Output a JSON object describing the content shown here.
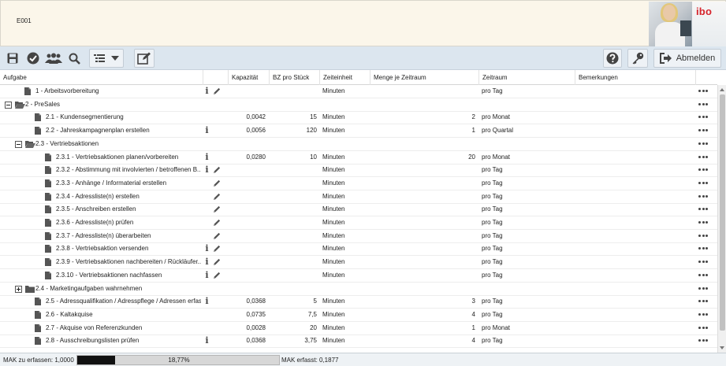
{
  "header": {
    "app_code": "E001",
    "logo_text": "ibo"
  },
  "toolbar": {
    "icons": [
      "save-icon",
      "check-icon",
      "users-icon",
      "search-icon",
      "list-view-icon",
      "chevron-down-icon",
      "edit-icon",
      "help-icon",
      "key-icon",
      "logout-icon"
    ],
    "logout_label": "Abmelden"
  },
  "grid": {
    "columns": {
      "aufgabe": "Aufgabe",
      "kapazitaet": "Kapazität",
      "bz_pro_stueck": "BZ pro Stück",
      "zeiteinheit": "Zeiteinheit",
      "menge_je_zeitraum": "Menge je Zeitraum",
      "zeitraum": "Zeitraum",
      "bemerkungen": "Bemerkungen"
    },
    "rows": [
      {
        "level": 1,
        "node": "doc",
        "label": "1 - Arbeitsvorbereitung",
        "info": true,
        "edit": true,
        "kapazitaet": "",
        "bz": "",
        "einheit": "Minuten",
        "menge": "",
        "zeitraum": "pro Tag"
      },
      {
        "level": 0,
        "node": "folder-open",
        "toggle": "minus",
        "label": "2 - PreSales",
        "info": false,
        "edit": false,
        "kapazitaet": "",
        "bz": "",
        "einheit": "",
        "menge": "",
        "zeitraum": ""
      },
      {
        "level": 2,
        "node": "doc",
        "label": "2.1 - Kundensegmentierung",
        "info": false,
        "edit": false,
        "kapazitaet": "0,0042",
        "bz": "15",
        "einheit": "Minuten",
        "menge": "2",
        "zeitraum": "pro Monat"
      },
      {
        "level": 2,
        "node": "doc",
        "label": "2.2 - Jahreskampagnenplan erstellen",
        "info": true,
        "edit": false,
        "kapazitaet": "0,0056",
        "bz": "120",
        "einheit": "Minuten",
        "menge": "1",
        "zeitraum": "pro Quartal"
      },
      {
        "level": 1,
        "node": "folder-open",
        "toggle": "minus",
        "label": "2.3 - Vertriebsaktionen",
        "info": false,
        "edit": false,
        "kapazitaet": "",
        "bz": "",
        "einheit": "",
        "menge": "",
        "zeitraum": ""
      },
      {
        "level": 3,
        "node": "doc",
        "label": "2.3.1 - Vertriebsaktionen planen/vorbereiten",
        "info": true,
        "edit": false,
        "kapazitaet": "0,0280",
        "bz": "10",
        "einheit": "Minuten",
        "menge": "20",
        "zeitraum": "pro Monat"
      },
      {
        "level": 3,
        "node": "doc",
        "label": "2.3.2 - Abstimmung mit involvierten / betroffenen B...",
        "info": true,
        "edit": true,
        "kapazitaet": "",
        "bz": "",
        "einheit": "Minuten",
        "menge": "",
        "zeitraum": "pro Tag"
      },
      {
        "level": 3,
        "node": "doc",
        "label": "2.3.3 - Anhänge / Informaterial erstellen",
        "info": false,
        "edit": true,
        "kapazitaet": "",
        "bz": "",
        "einheit": "Minuten",
        "menge": "",
        "zeitraum": "pro Tag"
      },
      {
        "level": 3,
        "node": "doc",
        "label": "2.3.4 - Adressliste(n) erstellen",
        "info": false,
        "edit": true,
        "kapazitaet": "",
        "bz": "",
        "einheit": "Minuten",
        "menge": "",
        "zeitraum": "pro Tag"
      },
      {
        "level": 3,
        "node": "doc",
        "label": "2.3.5 - Anschreiben erstellen",
        "info": false,
        "edit": true,
        "kapazitaet": "",
        "bz": "",
        "einheit": "Minuten",
        "menge": "",
        "zeitraum": "pro Tag"
      },
      {
        "level": 3,
        "node": "doc",
        "label": "2.3.6 - Adressliste(n) prüfen",
        "info": false,
        "edit": true,
        "kapazitaet": "",
        "bz": "",
        "einheit": "Minuten",
        "menge": "",
        "zeitraum": "pro Tag"
      },
      {
        "level": 3,
        "node": "doc",
        "label": "2.3.7 - Adressliste(n) überarbeiten",
        "info": false,
        "edit": true,
        "kapazitaet": "",
        "bz": "",
        "einheit": "Minuten",
        "menge": "",
        "zeitraum": "pro Tag"
      },
      {
        "level": 3,
        "node": "doc",
        "label": "2.3.8 - Vertriebsaktion versenden",
        "info": true,
        "edit": true,
        "kapazitaet": "",
        "bz": "",
        "einheit": "Minuten",
        "menge": "",
        "zeitraum": "pro Tag"
      },
      {
        "level": 3,
        "node": "doc",
        "label": "2.3.9 - Vertriebsaktionen nachbereiten / Rückläufer...",
        "info": true,
        "edit": true,
        "kapazitaet": "",
        "bz": "",
        "einheit": "Minuten",
        "menge": "",
        "zeitraum": "pro Tag"
      },
      {
        "level": 3,
        "node": "doc",
        "label": "2.3.10 - Vertriebsaktionen nachfassen",
        "info": true,
        "edit": true,
        "kapazitaet": "",
        "bz": "",
        "einheit": "Minuten",
        "menge": "",
        "zeitraum": "pro Tag"
      },
      {
        "level": 1,
        "node": "folder-closed",
        "toggle": "plus",
        "label": "2.4 - Marketingaufgaben wahrnehmen",
        "info": false,
        "edit": false,
        "kapazitaet": "",
        "bz": "",
        "einheit": "",
        "menge": "",
        "zeitraum": ""
      },
      {
        "level": 2,
        "node": "doc",
        "label": "2.5 - Adressqualifikation / Adresspflege / Adressen erfas...",
        "info": true,
        "edit": false,
        "kapazitaet": "0,0368",
        "bz": "5",
        "einheit": "Minuten",
        "menge": "3",
        "zeitraum": "pro Tag"
      },
      {
        "level": 2,
        "node": "doc",
        "label": "2.6 - Kaltakquise",
        "info": false,
        "edit": false,
        "kapazitaet": "0,0735",
        "bz": "7,5",
        "einheit": "Minuten",
        "menge": "4",
        "zeitraum": "pro Tag"
      },
      {
        "level": 2,
        "node": "doc",
        "label": "2.7 - Akquise von Referenzkunden",
        "info": false,
        "edit": false,
        "kapazitaet": "0,0028",
        "bz": "20",
        "einheit": "Minuten",
        "menge": "1",
        "zeitraum": "pro Monat"
      },
      {
        "level": 2,
        "node": "doc",
        "label": "2.8 - Ausschreibungslisten prüfen",
        "info": true,
        "edit": false,
        "kapazitaet": "0,0368",
        "bz": "3,75",
        "einheit": "Minuten",
        "menge": "4",
        "zeitraum": "pro Tag"
      }
    ]
  },
  "status": {
    "mak_zu_erfassen": "MAK zu erfassen: 1,0000",
    "progress_label": "18,77%",
    "progress_fraction": 0.1877,
    "mak_erfasst": "MAK erfasst: 0,1877"
  }
}
